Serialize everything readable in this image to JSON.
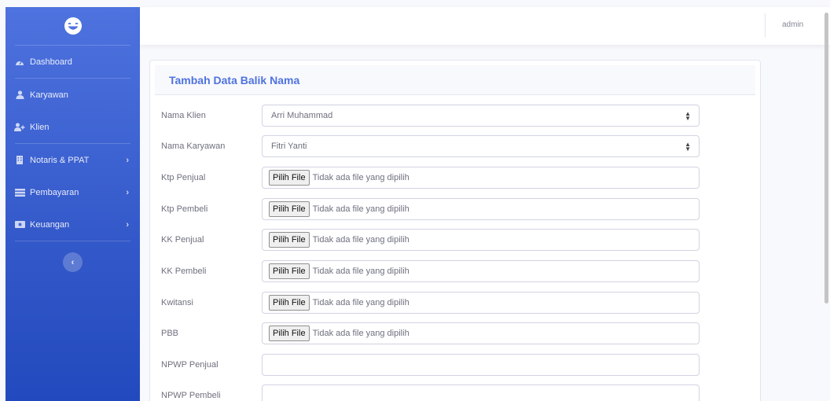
{
  "sidebar": {
    "brand_icon": "laughing-face-icon",
    "items": [
      {
        "label": "Dashboard",
        "icon": "tachometer-icon",
        "has_children": false
      },
      {
        "label": "Karyawan",
        "icon": "user-icon",
        "has_children": false
      },
      {
        "label": "Klien",
        "icon": "user-plus-icon",
        "has_children": false
      },
      {
        "label": "Notaris & PPAT",
        "icon": "building-icon",
        "has_children": true
      },
      {
        "label": "Pembayaran",
        "icon": "receipt-icon",
        "has_children": true
      },
      {
        "label": "Keuangan",
        "icon": "money-icon",
        "has_children": true
      }
    ],
    "chevron": "›",
    "toggle": "‹"
  },
  "topbar": {
    "user": "admin"
  },
  "form": {
    "title": "Tambah Data Balik Nama",
    "fields": [
      {
        "label": "Nama Klien",
        "type": "select",
        "value": "Arri Muhammad"
      },
      {
        "label": "Nama Karyawan",
        "type": "select",
        "value": "Fitri Yanti"
      },
      {
        "label": "Ktp Penjual",
        "type": "file",
        "button": "Pilih File",
        "status": "Tidak ada file yang dipilih"
      },
      {
        "label": "Ktp Pembeli",
        "type": "file",
        "button": "Pilih File",
        "status": "Tidak ada file yang dipilih"
      },
      {
        "label": "KK Penjual",
        "type": "file",
        "button": "Pilih File",
        "status": "Tidak ada file yang dipilih"
      },
      {
        "label": "KK Pembeli",
        "type": "file",
        "button": "Pilih File",
        "status": "Tidak ada file yang dipilih"
      },
      {
        "label": "Kwitansi",
        "type": "file",
        "button": "Pilih File",
        "status": "Tidak ada file yang dipilih"
      },
      {
        "label": "PBB",
        "type": "file",
        "button": "Pilih File",
        "status": "Tidak ada file yang dipilih"
      },
      {
        "label": "NPWP Penjual",
        "type": "text",
        "value": ""
      },
      {
        "label": "NPWP Pembeli",
        "type": "text",
        "value": ""
      }
    ]
  },
  "colors": {
    "primary": "#4e73df",
    "primary_dark": "#224abe"
  }
}
